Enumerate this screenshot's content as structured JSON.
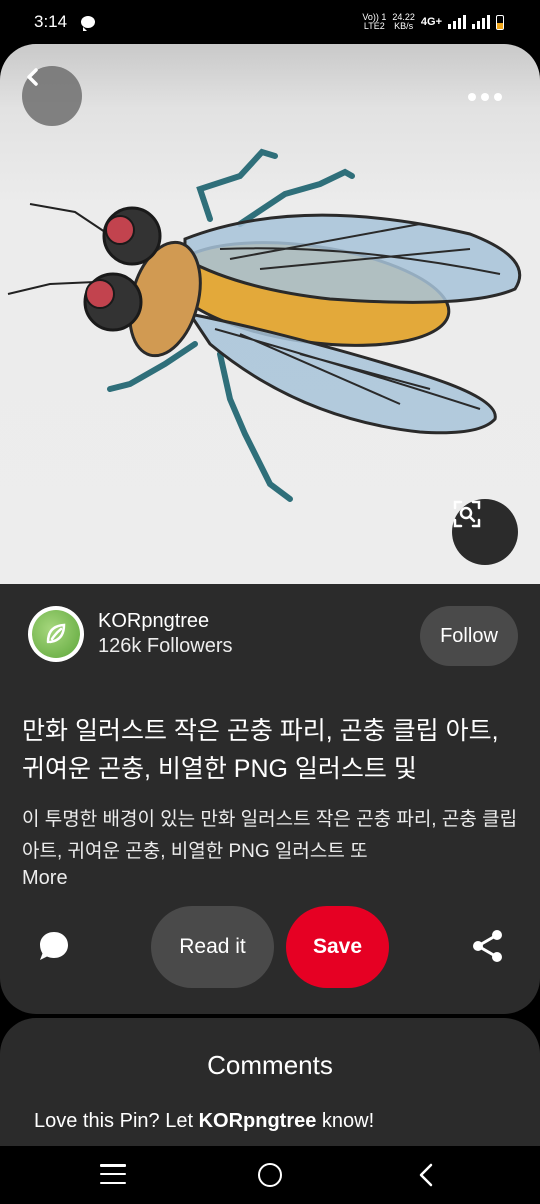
{
  "status_bar": {
    "time": "3:14",
    "volte": "Vo)) 1",
    "lte": "LTE2",
    "speed_value": "24.22",
    "speed_unit": "KB/s",
    "network": "4G+",
    "battery_color": "#f2a71b"
  },
  "pin": {
    "creator_name": "KORpngtree",
    "creator_followers": "126k Followers",
    "follow_label": "Follow",
    "title": "만화 일러스트 작은 곤충 파리, 곤충 클립 아트, 귀여운 곤충, 비열한 PNG 일러스트 및",
    "description": "이 투명한 배경이 있는 만화 일러스트 작은 곤충 파리, 곤충 클립 아트, 귀여운 곤충, 비열한 PNG 일러스트 또",
    "more_label": "More",
    "read_label": "Read it",
    "save_label": "Save",
    "save_color": "#e60023"
  },
  "comments": {
    "title": "Comments",
    "prompt_prefix": "Love this Pin? Let ",
    "prompt_name": "KORpngtree",
    "prompt_suffix": " know!"
  },
  "icons": [
    "back-icon",
    "more-icon",
    "visual-search-icon",
    "comment-icon",
    "share-icon",
    "nav-recent-icon",
    "nav-home-icon",
    "nav-back-icon"
  ]
}
